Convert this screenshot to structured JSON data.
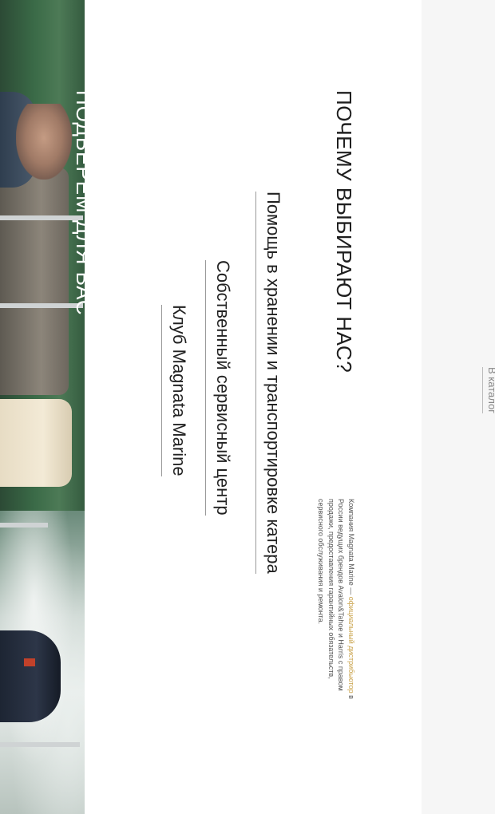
{
  "hero": {
    "title": "ПОДБЕРЕМ ДЛЯ ВАС"
  },
  "section": {
    "title": "ПОЧЕМУ ВЫБИРАЮТ НАС?"
  },
  "features": [
    {
      "label": "Помощь в хранении и транспортировке катера"
    },
    {
      "label": "Собственный сервисный центр"
    },
    {
      "label": "Клуб Magnata Marine"
    }
  ],
  "description": {
    "part1": "Компания Magnata Marine — ",
    "highlight": "официальный дистрибьютор",
    "part2": " в России ведущих брендов Avalon&Tahoe и Harris с правом продажи, предоставления гарантийных обязательств, сервисного обслуживания и ремонта."
  },
  "catalog": {
    "label": "В каталог"
  },
  "colors": {
    "accent": "#c9a24a",
    "side_panel": "#f6f6f6"
  }
}
